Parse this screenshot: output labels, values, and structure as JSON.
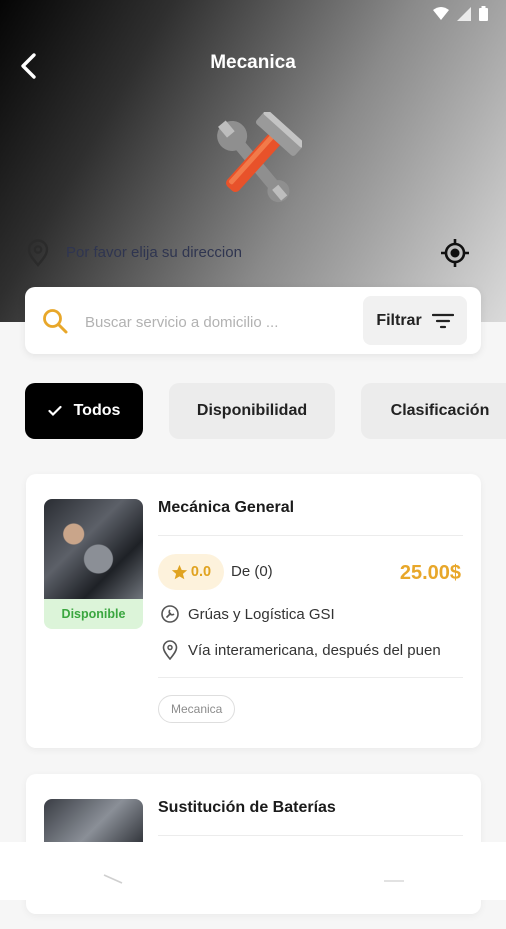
{
  "header": {
    "title": "Mecanica",
    "location_placeholder": "Por favor elija su direccion"
  },
  "search": {
    "placeholder": "Buscar servicio a domicilio ...",
    "filter_label": "Filtrar"
  },
  "chips": [
    {
      "label": "Todos",
      "active": true
    },
    {
      "label": "Disponibilidad",
      "active": false
    },
    {
      "label": "Clasificación",
      "active": false
    }
  ],
  "cards": [
    {
      "title": "Mecánica General",
      "status": "Disponible",
      "rating": "0.0",
      "reviews": "De (0)",
      "price": "25.00$",
      "provider": "Grúas y Logística GSI",
      "address": "Vía interamericana, después del puen",
      "tag": "Mecanica"
    },
    {
      "title": "Sustitución de Baterías"
    }
  ],
  "colors": {
    "accent": "#e8a72a",
    "available_bg": "#dcf4d9",
    "available_text": "#3aa63f",
    "active_chip": "#000000"
  }
}
